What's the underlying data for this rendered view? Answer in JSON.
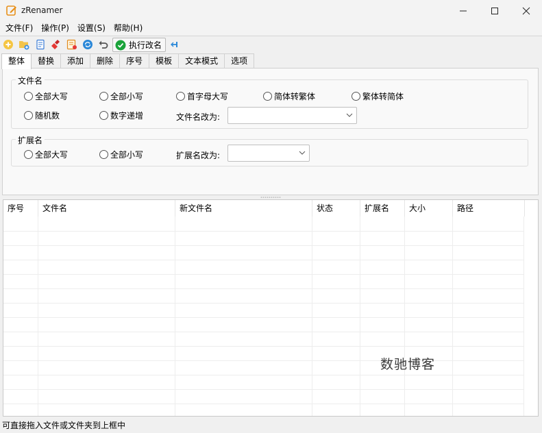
{
  "window": {
    "title": "zRenamer",
    "app_icon": "pencil-edit-icon",
    "controls": [
      "minimize-icon",
      "maximize-icon",
      "close-icon"
    ]
  },
  "menu": [
    "文件(F)",
    "操作(P)",
    "设置(S)",
    "帮助(H)"
  ],
  "toolbar": {
    "icons": [
      "add-file-icon",
      "add-folder-icon",
      "copy-list-icon",
      "clear-broom-icon",
      "rename-rule-icon",
      "refresh-icon",
      "undo-icon"
    ],
    "execute_label": "执行改名",
    "execute_icon": "check-circle-icon",
    "pin_icon": "pin-icon",
    "accent": "#1aa33a"
  },
  "tabs": [
    "整体",
    "替换",
    "添加",
    "删除",
    "序号",
    "模板",
    "文本模式",
    "选项"
  ],
  "active_tab": "整体",
  "filename_group": {
    "label": "文件名",
    "options_row1": [
      "全部大写",
      "全部小写",
      "首字母大写",
      "简体转繁体",
      "繁体转简体"
    ],
    "options_row2": [
      "随机数",
      "数字递增"
    ],
    "rename_to_label": "文件名改为:",
    "rename_to_value": ""
  },
  "extension_group": {
    "label": "扩展名",
    "options": [
      "全部大写",
      "全部小写"
    ],
    "rename_to_label": "扩展名改为:",
    "rename_to_value": ""
  },
  "table": {
    "columns": [
      "序号",
      "文件名",
      "新文件名",
      "状态",
      "扩展名",
      "大小",
      "路径"
    ],
    "rows": []
  },
  "watermark": "数驰博客",
  "status": "可直接拖入文件或文件夹到上框中"
}
